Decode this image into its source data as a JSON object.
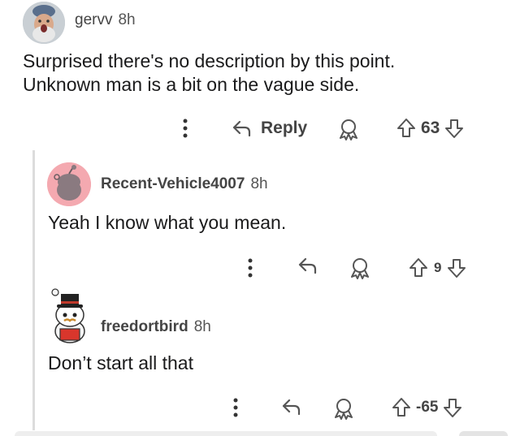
{
  "comments": [
    {
      "username": "gervv",
      "time": "8h",
      "body_lines": [
        "Surprised there's no description by this point.",
        "Unknown man is a bit on the vague side."
      ],
      "reply_label": "Reply",
      "votes": "63",
      "avatar_icon": "photo-avatar-icon"
    },
    {
      "username": "Recent-Vehicle4007",
      "time": "8h",
      "body": "Yeah I know what you mean.",
      "votes": "9",
      "avatar_icon": "snoo-avatar-icon"
    },
    {
      "username": "freedortbird",
      "time": "8h",
      "body": "Don’t start all that",
      "votes": "-65",
      "avatar_icon": "snoo-tophat-avatar-icon"
    }
  ],
  "colors": {
    "pink_avatar_bg": "#f4a9b0",
    "thread_line": "#dcdcdc",
    "text": "#1a1a1b",
    "icon": "#555555"
  }
}
